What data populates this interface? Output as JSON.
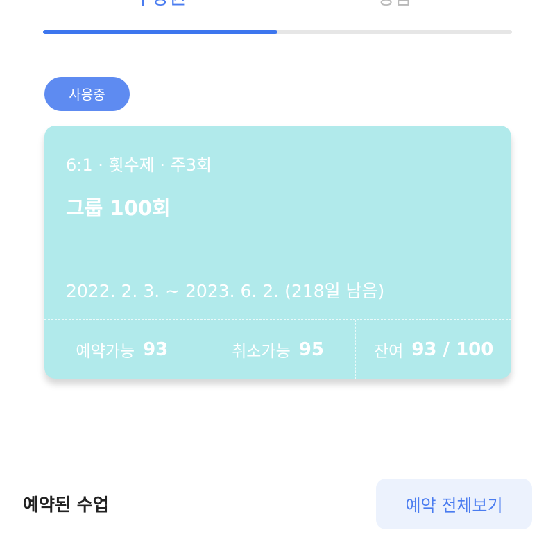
{
  "tabs": {
    "active_label": "수강권",
    "inactive_label": "상품",
    "progress_fraction": 0.5
  },
  "status_badge": "사용중",
  "card": {
    "meta": "6:1 · 횟수제 · 주3회",
    "title": "그룹 100회",
    "period": "2022. 2. 3. ~ 2023. 6. 2. (218일 남음)",
    "stats": [
      {
        "label": "예약가능",
        "value": "93"
      },
      {
        "label": "취소가능",
        "value": "95"
      },
      {
        "label": "잔여",
        "value": "93 / 100"
      }
    ]
  },
  "reserved_section": {
    "title": "예약된 수업",
    "view_all_label": "예약 전체보기"
  },
  "colors": {
    "accent": "#3d76ee",
    "card_bg": "#b1eaeb",
    "badge_bg": "#5e8bf1"
  }
}
